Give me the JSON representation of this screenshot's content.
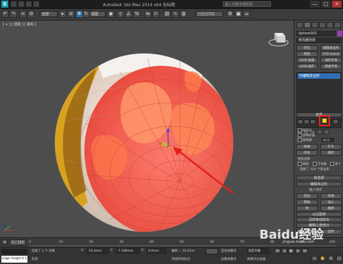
{
  "title_bar": {
    "logo": "S",
    "title": "Autodesk 3ds Max 2014 x64   无标题",
    "search_placeholder": "键入关键字或短语",
    "controls": [
      "—",
      "□",
      "✕"
    ]
  },
  "toolbar": {
    "select_filter": "全部",
    "view_dropdown": "视图",
    "selection_set": "创建选择集"
  },
  "viewport": {
    "label": "[ + ] [ 透视 ] [ 真实 ]"
  },
  "command_panel": {
    "object_name": "Sphere001",
    "object_color": "#9b3dbd",
    "modifier_list": "修改器列表",
    "modifier_buttons": [
      "挤出",
      "编辑多边形",
      "倒角",
      "FFD 4x4x4",
      "UVW 贴图",
      "涡轮平滑",
      "UVW 展开",
      "网格平滑"
    ],
    "stack_item": "可编辑多边形",
    "rollout_selection": "选择",
    "by_vertex": "按顶点",
    "ignore_backfacing": "忽略背面",
    "by_angle": "按角度",
    "angle_value": "45.0",
    "shrink": "收缩",
    "grow": "扩大",
    "ring": "环形",
    "loop": "循环",
    "preview_selection": "预览选择",
    "preview_options": [
      "禁用",
      "子对象",
      "多个"
    ],
    "selection_status": "选择了 324 个多边形",
    "rollout_soft": "软选择",
    "rollout_edit_poly": "编辑多边形",
    "insert_vertex": "插入顶点",
    "edit_buttons": [
      "挤出",
      "轮廓",
      "倒角",
      "插入",
      "桥",
      "翻转",
      "从边旋转",
      "沿样条线挤出",
      "编辑三角剖分",
      "重复三角算法",
      "旋转"
    ]
  },
  "timeline": {
    "frame_display": "0 / 100",
    "ticks": [
      "0",
      "10",
      "20",
      "30",
      "40",
      "50",
      "60",
      "70",
      "80",
      "90",
      "100"
    ]
  },
  "status_bar": {
    "maxscript": "Edge Height 0.1",
    "selected": "选择了 1 个 对象",
    "prompt": "欢迎",
    "x_label": "X:",
    "x_value": "-55.0mm",
    "y_label": "Y:",
    "y_value": "-7.308mm",
    "z_label": "Z:",
    "z_value": "0.0mm",
    "grid": "栅格 = 10.0mm",
    "auto_key": "自动关键点",
    "set_key": "设置关键点",
    "selected_obj": "选定对象",
    "key_filters": "关键点过滤器...",
    "add_time_tag": "添加时间标记"
  },
  "watermark": {
    "text": "Baidu经验",
    "sub": "jingyan.baidu.com"
  }
}
